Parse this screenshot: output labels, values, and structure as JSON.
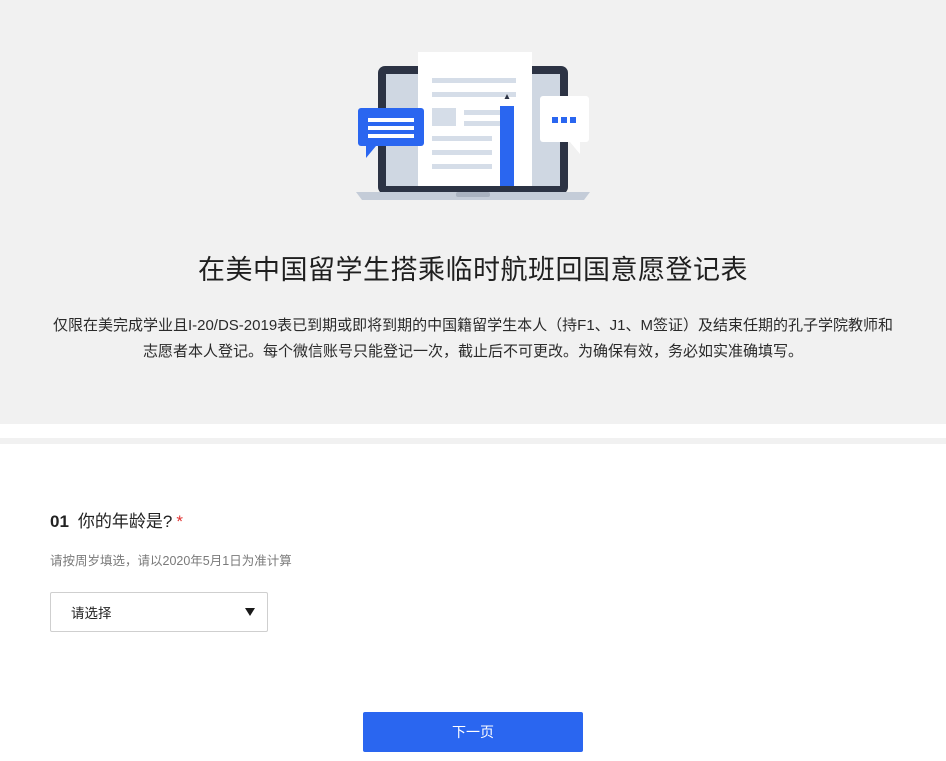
{
  "header": {
    "title": "在美中国留学生搭乘临时航班回国意愿登记表",
    "description": "仅限在美完成学业且I-20/DS-2019表已到期或即将到期的中国籍留学生本人（持F1、J1、M签证）及结束任期的孔子学院教师和志愿者本人登记。每个微信账号只能登记一次，截止后不可更改。为确保有效，务必如实准确填写。",
    "illustration_icon": "laptop-document-chat-illustration"
  },
  "question": {
    "number": "01",
    "label": "你的年龄是?",
    "required_mark": "*",
    "hint": "请按周岁填选，请以2020年5月1日为准计算",
    "select_value": "请选择"
  },
  "footer": {
    "next_label": "下一页"
  },
  "colors": {
    "accent": "#2a66f0",
    "hero_bg": "#f1f1f1",
    "required": "#e0302f"
  }
}
